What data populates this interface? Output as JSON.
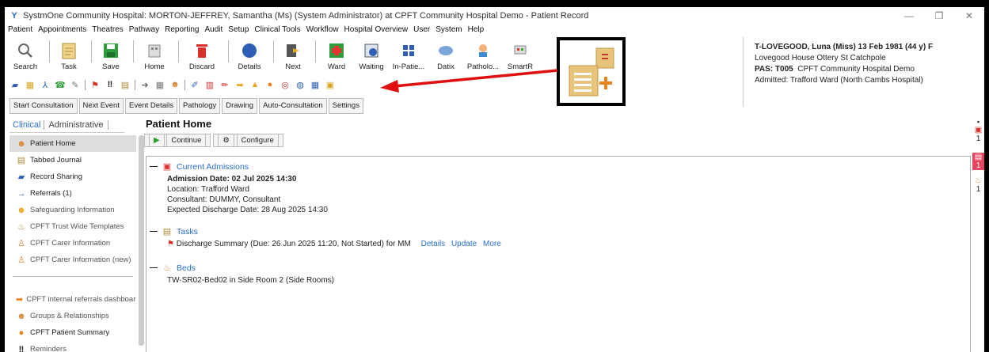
{
  "window": {
    "title": "SystmOne Community Hospital: MORTON-JEFFREY, Samantha (Ms) (System Administrator) at CPFT Community Hospital Demo - Patient Record",
    "controls": [
      "—",
      "❐",
      "✕"
    ]
  },
  "menu": [
    "Patient",
    "Appointments",
    "Theatres",
    "Pathway",
    "Reporting",
    "Audit",
    "Setup",
    "Clinical Tools",
    "Workflow",
    "Hospital Overview",
    "User",
    "System",
    "Help"
  ],
  "toolbar": {
    "search": "Search",
    "task": "Task",
    "save": "Save",
    "home": "Home",
    "discard": "Discard",
    "details": "Details",
    "next": "Next",
    "ward": "Ward",
    "waiting": "Waiting",
    "inpatients": "In-Patie...",
    "datix": "Datix",
    "pathology": "Patholo...",
    "smartr": "SmartR"
  },
  "patient": {
    "name": "T-LOVEGOOD, Luna (Miss) 13 Feb 1981 (44 y) F",
    "address": "Lovegood House Ottery St Catchpole",
    "pas_label": "PAS: T005",
    "pas_org": "CPFT Community Hospital Demo",
    "admitted": "Admitted: Trafford Ward (North Cambs Hospital)"
  },
  "tabs": [
    "Start Consultation",
    "Next Event",
    "Event Details",
    "Pathology",
    "Drawing",
    "Auto-Consultation",
    "Settings"
  ],
  "left_tabs": {
    "clinical": "Clinical",
    "administrative": "Administrative"
  },
  "nav": {
    "patient_home": "Patient Home",
    "tabbed_journal": "Tabbed Journal",
    "record_sharing": "Record Sharing",
    "referrals": "Referrals (1)",
    "safeguarding": "Safeguarding Information",
    "trust_templates": "CPFT Trust Wide Templates",
    "carer_info": "CPFT Carer Information",
    "carer_info_new": "CPFT Carer Information (new)",
    "internal_referrals": "CPFT internal referrals dashboard",
    "groups": "Groups & Relationships",
    "patient_summary": "CPFT Patient Summary",
    "reminders": "Reminders"
  },
  "main": {
    "title": "Patient Home",
    "continue": "Continue",
    "configure": "Configure"
  },
  "admissions": {
    "title": "Current Admissions",
    "date": "Admission Date: 02 Jul 2025 14:30",
    "location": "Location: Trafford Ward",
    "consultant": "Consultant: DUMMY, Consultant",
    "discharge": "Expected Discharge Date: 28 Aug 2025 14:30"
  },
  "tasks": {
    "title": "Tasks",
    "item": "Discharge Summary (Due: 26 Jun 2025 11:20, Not Started) for MM",
    "details": "Details",
    "update": "Update",
    "more": "More"
  },
  "beds": {
    "title": "Beds",
    "item": "TW-SR02-Bed02 in Side Room 2 (Side Rooms)"
  },
  "right_strip": {
    "count1": "1",
    "count2": "1",
    "count3": "1"
  },
  "colors": {
    "accent": "#2a6fcf",
    "highlight": "#e8445f",
    "arrow": "#e01010"
  }
}
